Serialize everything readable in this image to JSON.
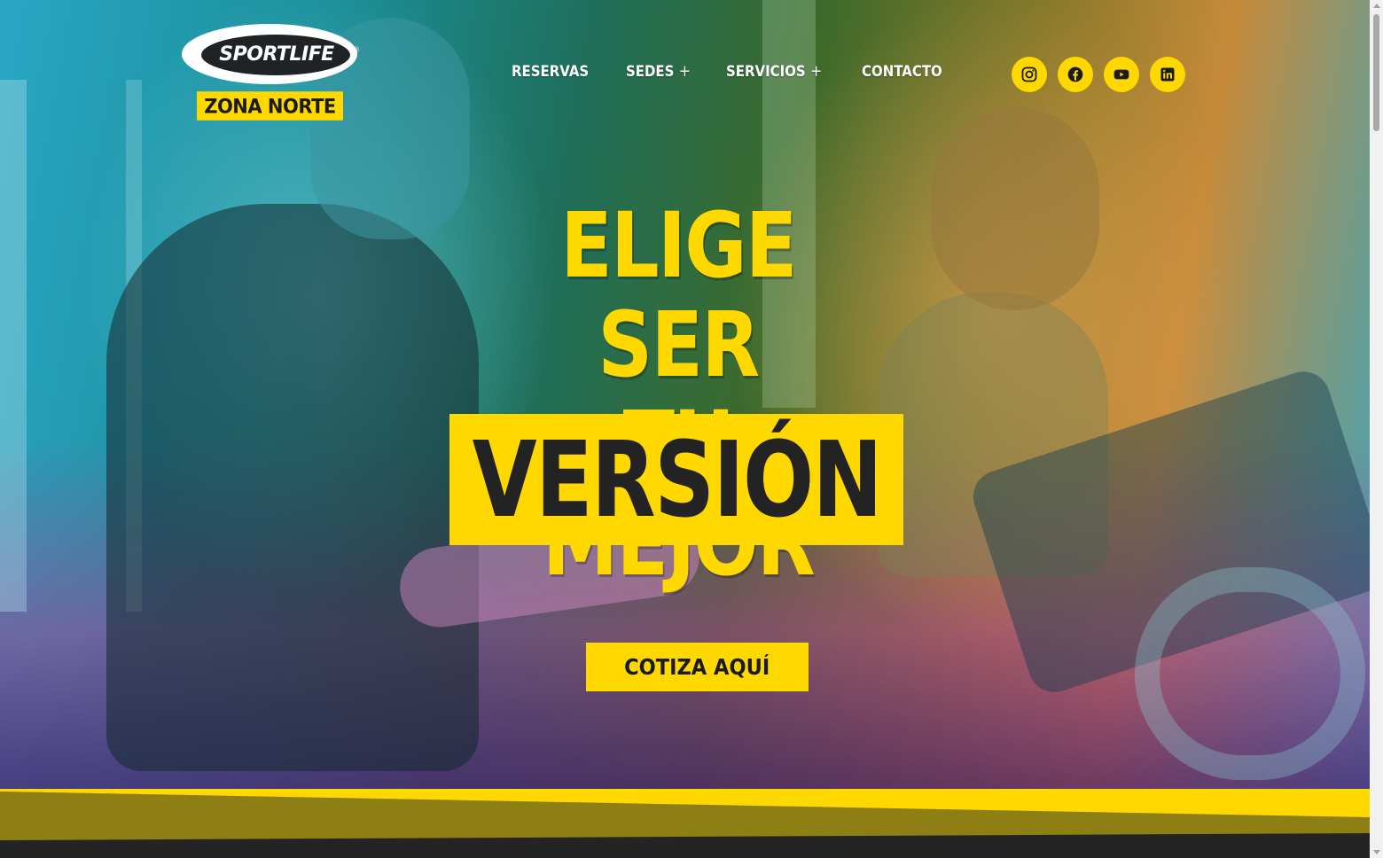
{
  "brand": {
    "logo_text": "SPORTLIFE",
    "logo_reg": "®",
    "zone": "ZONA NORTE"
  },
  "nav": {
    "items": [
      {
        "label": "RESERVAS",
        "has_submenu": false
      },
      {
        "label": "SEDES",
        "has_submenu": true,
        "submenu_indicator": "+"
      },
      {
        "label": "SERVICIOS",
        "has_submenu": true,
        "submenu_indicator": "+"
      },
      {
        "label": "CONTACTO",
        "has_submenu": false
      }
    ]
  },
  "social": [
    {
      "name": "instagram-icon"
    },
    {
      "name": "facebook-icon"
    },
    {
      "name": "youtube-icon"
    },
    {
      "name": "linkedin-icon"
    }
  ],
  "hero": {
    "line1": "ELIGE SER",
    "line2": "TU MEJOR",
    "line3": "VERSIÓN",
    "cta_label": "COTIZA AQUÍ"
  },
  "colors": {
    "accent": "#ffd800",
    "dark": "#1b1b1b",
    "band_dark": "#242424",
    "band_olive": "#8d7f14"
  }
}
